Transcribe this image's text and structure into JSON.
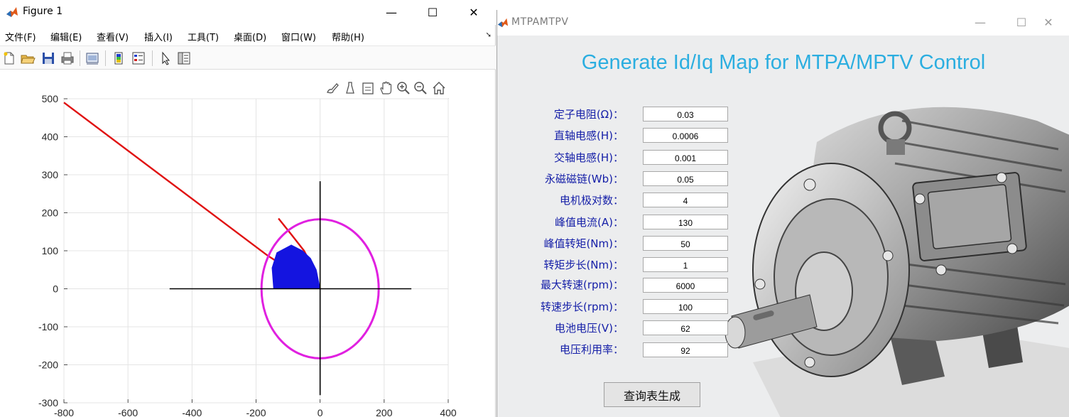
{
  "figure_window": {
    "title": "Figure 1",
    "controls": {
      "minimize": "—",
      "maximize": "☐",
      "close": "✕"
    },
    "menu": [
      "文件(F)",
      "编辑(E)",
      "查看(V)",
      "插入(I)",
      "工具(T)",
      "桌面(D)",
      "窗口(W)",
      "帮助(H)"
    ],
    "toolbar_icons": [
      "new-file-icon",
      "open-folder-icon",
      "save-icon",
      "print-icon",
      "link-figure-icon",
      "colorbar-icon",
      "legend-icon",
      "pointer-icon",
      "property-editor-icon"
    ],
    "axes_toolbar_icons": [
      "brush-icon",
      "data-tips-icon",
      "export-icon",
      "pan-icon",
      "zoom-in-icon",
      "zoom-out-icon",
      "home-icon"
    ]
  },
  "chart_data": {
    "type": "line",
    "title": "",
    "xlabel": "",
    "ylabel": "",
    "xlim": [
      -800,
      400
    ],
    "ylim": [
      -300,
      500
    ],
    "xticks": [
      -800,
      -600,
      -400,
      -200,
      0,
      200,
      400
    ],
    "yticks": [
      -300,
      -200,
      -100,
      0,
      100,
      200,
      300,
      400,
      500
    ],
    "grid": true,
    "series": [
      {
        "label": "voltage-limit line",
        "color": "#e01010",
        "points": [
          [
            -800,
            490
          ],
          [
            -165,
            88
          ],
          [
            -110,
            58
          ],
          [
            -95,
            25
          ],
          [
            -85,
            2
          ]
        ]
      },
      {
        "label": "MTPA curve",
        "color": "#e01010",
        "points": [
          [
            0,
            0
          ],
          [
            -20,
            50
          ],
          [
            -50,
            100
          ],
          [
            -90,
            143
          ],
          [
            -130,
            185
          ]
        ]
      },
      {
        "label": "current limit circle",
        "color": "#e020e0",
        "center": [
          0,
          0
        ],
        "radius": 183
      },
      {
        "label": "operating region",
        "color": "#1414e0",
        "points": [
          [
            -85,
            0
          ],
          [
            -145,
            0
          ],
          [
            -150,
            55
          ],
          [
            -135,
            95
          ],
          [
            -90,
            115
          ],
          [
            -55,
            100
          ],
          [
            -30,
            80
          ],
          [
            -12,
            50
          ],
          [
            0,
            0
          ]
        ]
      },
      {
        "label": "x axis line",
        "color": "#000000",
        "points": [
          [
            -470,
            0
          ],
          [
            285,
            0
          ]
        ]
      },
      {
        "label": "y axis line",
        "color": "#000000",
        "points": [
          [
            0,
            -280
          ],
          [
            0,
            283
          ]
        ]
      }
    ]
  },
  "app_window": {
    "title": "MTPAMTPV",
    "controls": {
      "minimize": "—",
      "maximize": "☐",
      "close": "✕"
    },
    "heading": "Generate Id/Iq Map for MTPA/MPTV Control",
    "params": [
      {
        "label": "定子电阻(Ω)：",
        "value": "0.03"
      },
      {
        "label": "直轴电感(H)：",
        "value": "0.0006"
      },
      {
        "label": "交轴电感(H)：",
        "value": "0.001"
      },
      {
        "label": "永磁磁链(Wb)：",
        "value": "0.05"
      },
      {
        "label": "电机极对数：",
        "value": "4"
      },
      {
        "label": "峰值电流(A)：",
        "value": "130"
      },
      {
        "label": "峰值转矩(Nm)：",
        "value": "50"
      },
      {
        "label": "转矩步长(Nm)：",
        "value": "1"
      },
      {
        "label": "最大转速(rpm)：",
        "value": "6000"
      },
      {
        "label": "转速步长(rpm)：",
        "value": "100"
      },
      {
        "label": "电池电压(V)：",
        "value": "62"
      },
      {
        "label": "电压利用率：",
        "value": "92"
      }
    ],
    "generate_button": "查询表生成",
    "background_image": "electric-motor-image"
  }
}
